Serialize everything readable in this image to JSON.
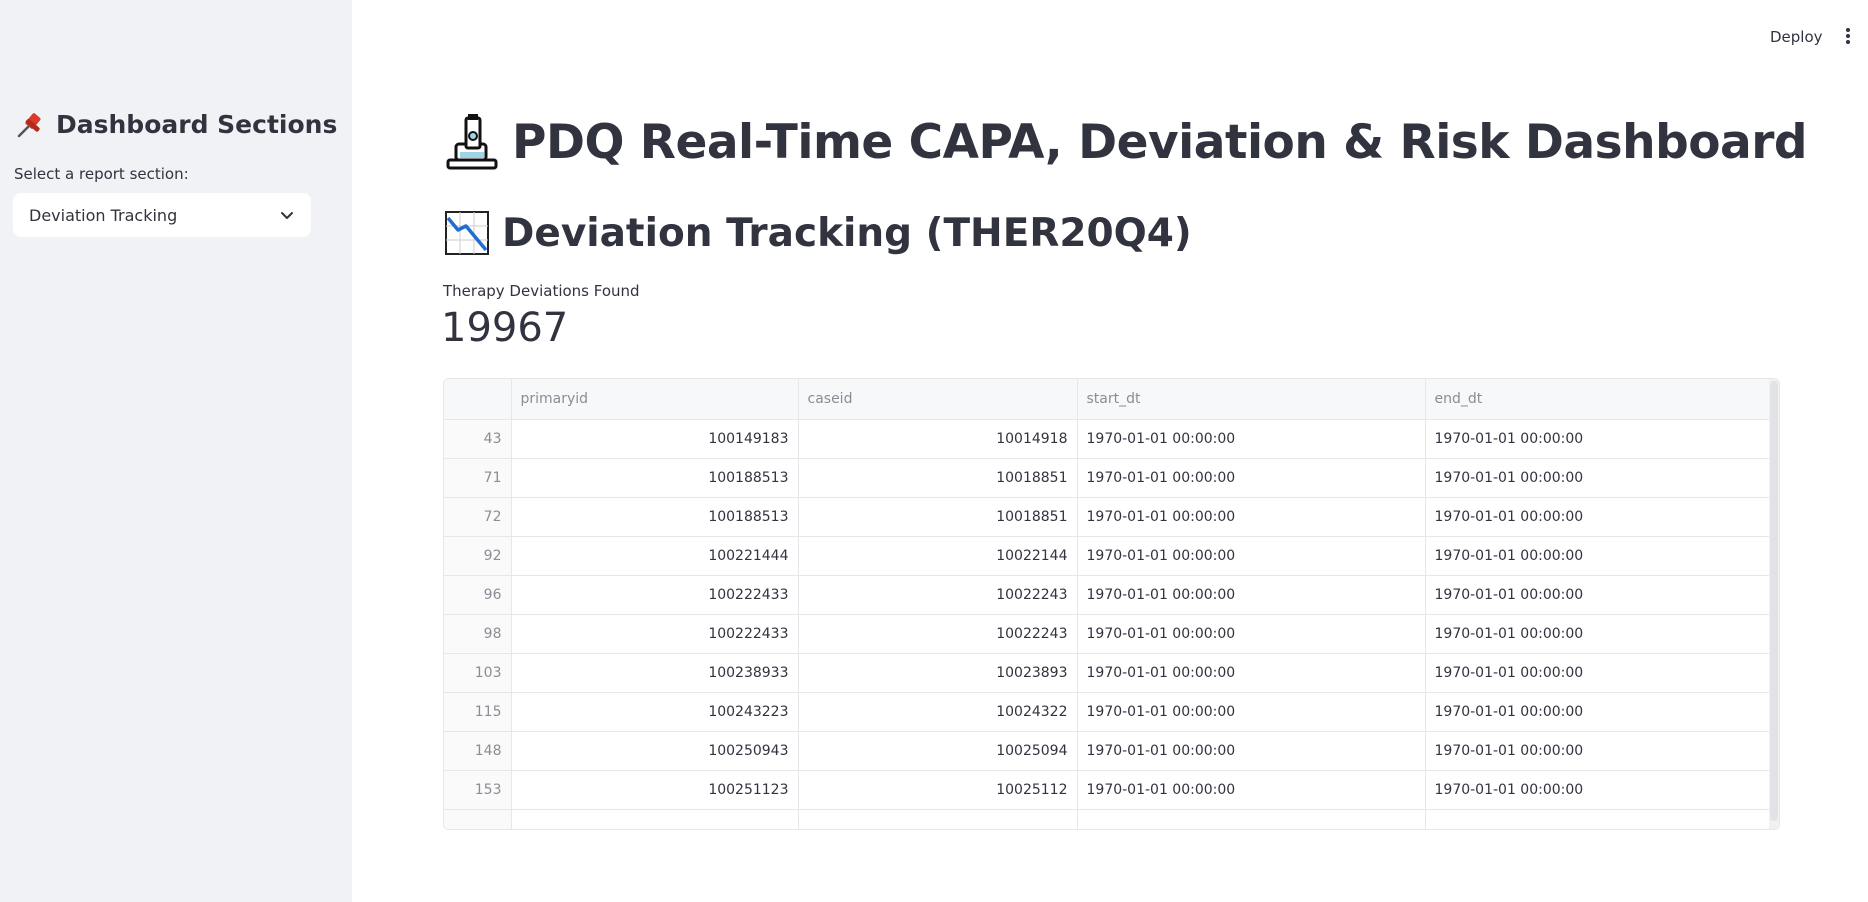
{
  "header": {
    "deploy_label": "Deploy",
    "menu_icon": "more-vertical-icon"
  },
  "sidebar": {
    "icon": "pushpin-icon",
    "title": "Dashboard Sections",
    "select_label": "Select a report section:",
    "selected_option": "Deviation Tracking"
  },
  "main": {
    "title_icon": "microscope-icon",
    "title": "PDQ Real-Time CAPA, Deviation & Risk Dashboard",
    "section_icon": "chart-decreasing-icon",
    "section_title": "Deviation Tracking (THER20Q4)",
    "metric_label": "Therapy Deviations Found",
    "metric_value": "19967"
  },
  "table": {
    "columns": [
      "",
      "primaryid",
      "caseid",
      "start_dt",
      "end_dt"
    ],
    "rows": [
      {
        "index": "43",
        "primaryid": "100149183",
        "caseid": "10014918",
        "start_dt": "1970-01-01 00:00:00",
        "end_dt": "1970-01-01 00:00:00"
      },
      {
        "index": "71",
        "primaryid": "100188513",
        "caseid": "10018851",
        "start_dt": "1970-01-01 00:00:00",
        "end_dt": "1970-01-01 00:00:00"
      },
      {
        "index": "72",
        "primaryid": "100188513",
        "caseid": "10018851",
        "start_dt": "1970-01-01 00:00:00",
        "end_dt": "1970-01-01 00:00:00"
      },
      {
        "index": "92",
        "primaryid": "100221444",
        "caseid": "10022144",
        "start_dt": "1970-01-01 00:00:00",
        "end_dt": "1970-01-01 00:00:00"
      },
      {
        "index": "96",
        "primaryid": "100222433",
        "caseid": "10022243",
        "start_dt": "1970-01-01 00:00:00",
        "end_dt": "1970-01-01 00:00:00"
      },
      {
        "index": "98",
        "primaryid": "100222433",
        "caseid": "10022243",
        "start_dt": "1970-01-01 00:00:00",
        "end_dt": "1970-01-01 00:00:00"
      },
      {
        "index": "103",
        "primaryid": "100238933",
        "caseid": "10023893",
        "start_dt": "1970-01-01 00:00:00",
        "end_dt": "1970-01-01 00:00:00"
      },
      {
        "index": "115",
        "primaryid": "100243223",
        "caseid": "10024322",
        "start_dt": "1970-01-01 00:00:00",
        "end_dt": "1970-01-01 00:00:00"
      },
      {
        "index": "148",
        "primaryid": "100250943",
        "caseid": "10025094",
        "start_dt": "1970-01-01 00:00:00",
        "end_dt": "1970-01-01 00:00:00"
      },
      {
        "index": "153",
        "primaryid": "100251123",
        "caseid": "10025112",
        "start_dt": "1970-01-01 00:00:00",
        "end_dt": "1970-01-01 00:00:00"
      },
      {
        "index": "",
        "primaryid": "",
        "caseid": "",
        "start_dt": "",
        "end_dt": ""
      }
    ]
  },
  "colors": {
    "sidebar_bg": "#f0f2f6",
    "text": "#31333f",
    "muted_text": "#8a8d96",
    "border": "#e6e7ea"
  }
}
